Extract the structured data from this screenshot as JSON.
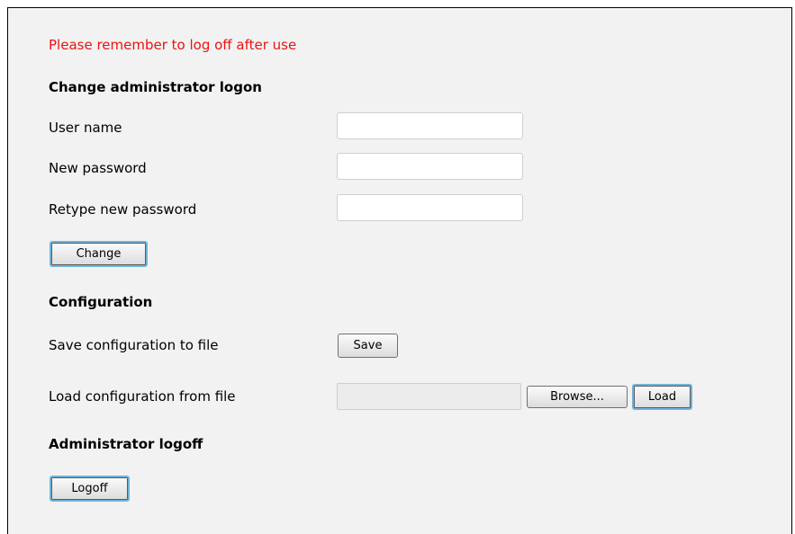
{
  "notice": "Please remember to log off after use",
  "change_logon": {
    "heading": "Change administrator logon",
    "username_label": "User name",
    "username_value": "",
    "new_password_label": "New password",
    "new_password_value": "",
    "retype_password_label": "Retype new password",
    "retype_password_value": "",
    "change_button": "Change"
  },
  "configuration": {
    "heading": "Configuration",
    "save_label": "Save configuration to file",
    "save_button": "Save",
    "load_label": "Load configuration from file",
    "file_value": "",
    "browse_button": "Browse...",
    "load_button": "Load"
  },
  "logoff": {
    "heading": "Administrator logoff",
    "logoff_button": "Logoff"
  },
  "colors": {
    "notice": "#ee1111",
    "panel_background": "#f2f2f2",
    "focus_border": "#6fb3d8"
  }
}
